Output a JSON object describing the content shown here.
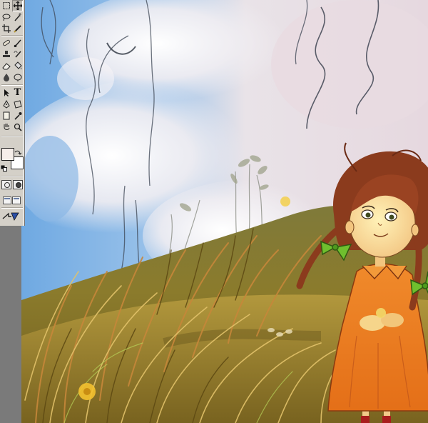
{
  "app": {
    "name": "image editor"
  },
  "toolbox": {
    "tools": [
      {
        "id": "marquee",
        "icon": "marquee-icon"
      },
      {
        "id": "move",
        "icon": "move-icon"
      },
      {
        "id": "lasso",
        "icon": "lasso-icon"
      },
      {
        "id": "magic-wand",
        "icon": "magic-wand-icon"
      },
      {
        "id": "crop",
        "icon": "crop-icon"
      },
      {
        "id": "slice",
        "icon": "slice-icon"
      },
      {
        "id": "healing-brush",
        "icon": "bandage-icon"
      },
      {
        "id": "brush",
        "icon": "brush-icon"
      },
      {
        "id": "clone-stamp",
        "icon": "stamp-icon"
      },
      {
        "id": "history-brush",
        "icon": "history-brush-icon"
      },
      {
        "id": "eraser",
        "icon": "eraser-icon"
      },
      {
        "id": "paint-bucket",
        "icon": "paint-bucket-icon"
      },
      {
        "id": "blur",
        "icon": "blur-drop-icon"
      },
      {
        "id": "dodge",
        "icon": "dodge-icon"
      },
      {
        "id": "path-selection",
        "icon": "path-selection-icon"
      },
      {
        "id": "type",
        "icon": "type-icon",
        "label": "T"
      },
      {
        "id": "pen",
        "icon": "pen-icon"
      },
      {
        "id": "shape",
        "icon": "custom-shape-icon"
      },
      {
        "id": "notes",
        "icon": "notes-icon"
      },
      {
        "id": "eyedropper",
        "icon": "eyedropper-icon"
      },
      {
        "id": "hand",
        "icon": "hand-icon"
      },
      {
        "id": "zoom",
        "icon": "zoom-icon"
      }
    ],
    "colors": {
      "foreground": "#f6efea",
      "background": "#ffffff"
    }
  },
  "canvas": {
    "description_icon": "painting-canvas",
    "palette": {
      "sky_blue": "#7fb2e4",
      "cloud_white": "#f4f1f1",
      "mist_pink": "#e7d9df",
      "grass_olive": "#8a7a2c",
      "grass_gold": "#c6a84a",
      "dress_orange": "#e77a20",
      "hair_brown": "#8a3a1e",
      "ribbon_green": "#6fbf2e"
    }
  }
}
